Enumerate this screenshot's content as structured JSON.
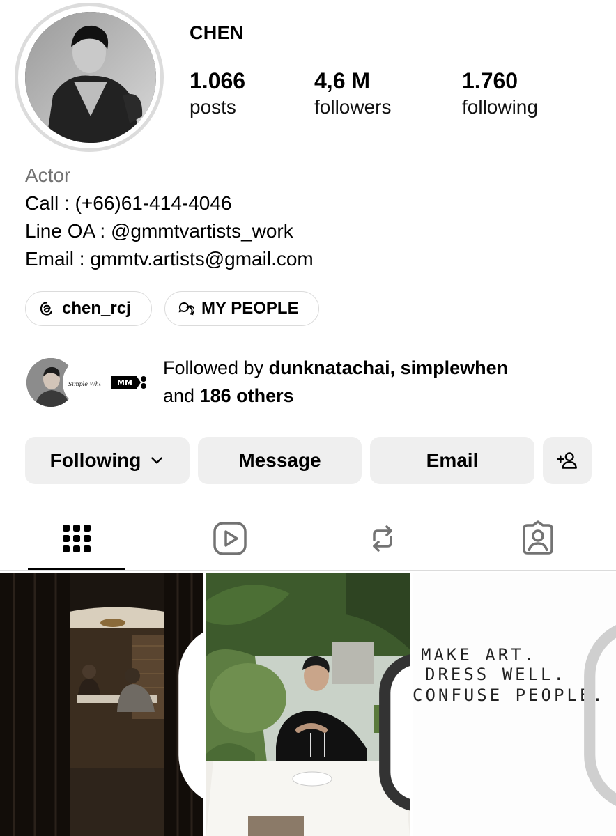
{
  "profile": {
    "username": "CHEN",
    "stats": [
      {
        "value": "1.066",
        "label": "posts"
      },
      {
        "value": "4,6 M",
        "label": "followers"
      },
      {
        "value": "1.760",
        "label": "following"
      }
    ],
    "bio": {
      "category": "Actor",
      "lines": [
        "Call : (+66)61-414-4046",
        "Line OA : @gmmtvartists_work",
        "Email : gmmtv.artists@gmail.com"
      ]
    },
    "chips": [
      {
        "label": "chen_rcj",
        "icon": "threads-icon"
      },
      {
        "label": "MY PEOPLE",
        "icon": "chat-bubbles-icon"
      }
    ]
  },
  "mutuals": {
    "prefix": "Followed by ",
    "names": "dunknatachai, simplewhen",
    "and": "and ",
    "others": "186 others",
    "avatar_text_1": "Simple When?",
    "avatar_text_2": "MM"
  },
  "actions": {
    "following": "Following",
    "message": "Message",
    "email": "Email",
    "add_icon": "add-person-icon"
  },
  "tabs": [
    {
      "name": "grid",
      "icon": "grid-icon",
      "active": true
    },
    {
      "name": "reels",
      "icon": "reels-icon",
      "active": false
    },
    {
      "name": "reposts",
      "icon": "repost-icon",
      "active": false
    },
    {
      "name": "tagged",
      "icon": "tagged-icon",
      "active": false
    }
  ],
  "posts": [
    {
      "type": "reel",
      "badge": "reel-icon"
    },
    {
      "type": "multi",
      "badge": "carousel-icon"
    },
    {
      "type": "reel",
      "badge": "reel-icon",
      "handwritten_text": [
        "MAKE ART.",
        "DRESS WELL.",
        "CONFUSE PEOPLE."
      ]
    }
  ],
  "colors": {
    "button_bg": "#efefef",
    "muted_text": "#737373",
    "border": "#dbdbdb"
  }
}
